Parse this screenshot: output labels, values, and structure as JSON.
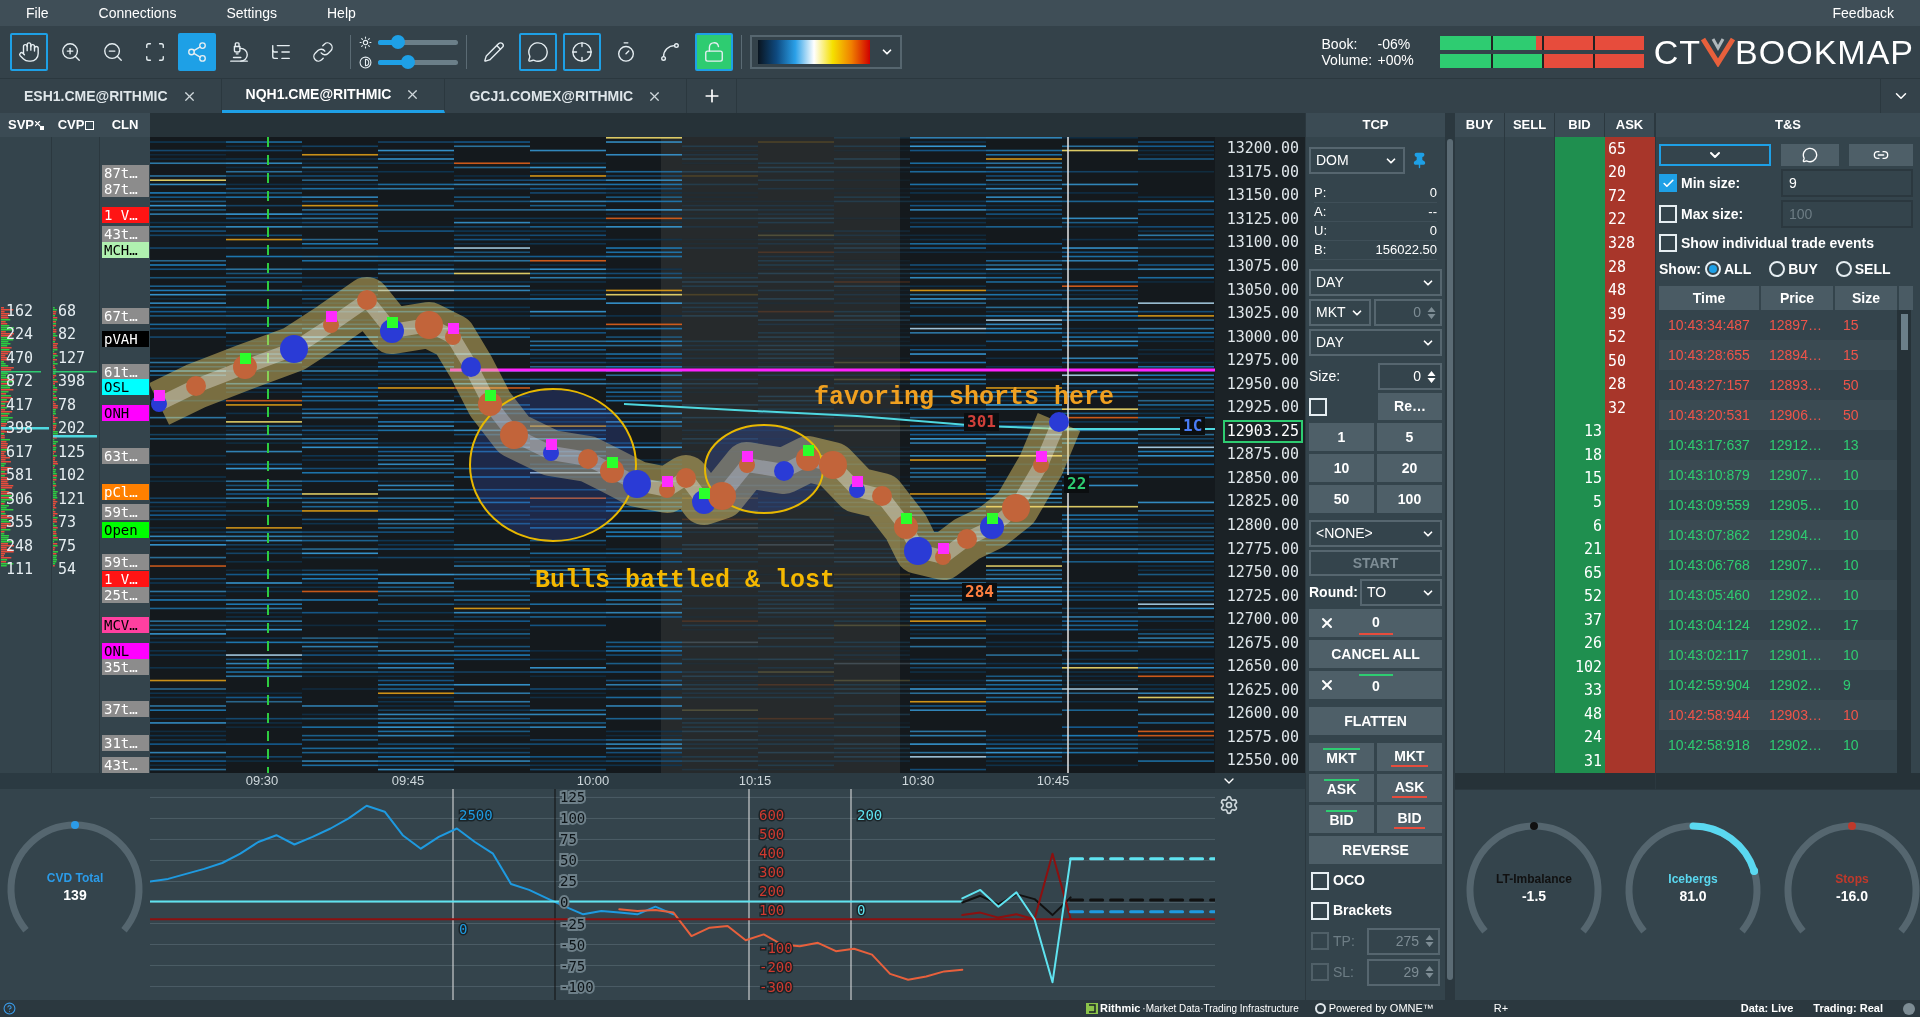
{
  "menu": {
    "items": [
      "File",
      "Connections",
      "Settings",
      "Help"
    ],
    "feedback": "Feedback"
  },
  "toolbar": {
    "tools": [
      {
        "kind": "hand",
        "selected": true,
        "on": false
      },
      {
        "kind": "zoom-in",
        "selected": false,
        "on": false
      },
      {
        "kind": "zoom-out",
        "selected": false,
        "on": false
      },
      {
        "kind": "zoom-fit",
        "selected": false,
        "on": false
      },
      {
        "kind": "share",
        "selected": false,
        "on": true
      },
      {
        "kind": "microscope",
        "selected": false,
        "on": false
      },
      {
        "kind": "tree",
        "selected": false,
        "on": false
      },
      {
        "kind": "link",
        "selected": false,
        "on": false
      }
    ],
    "sliders": [
      {
        "kind": "brightness",
        "level": 0.25
      },
      {
        "kind": "contrast",
        "level": 0.37
      }
    ],
    "tools2": [
      {
        "kind": "pencil",
        "selected": false,
        "on": false
      },
      {
        "kind": "chat",
        "selected": true,
        "on": false
      },
      {
        "kind": "crosshair",
        "selected": true,
        "on": false
      },
      {
        "kind": "timer",
        "selected": false,
        "on": false
      },
      {
        "kind": "chart",
        "selected": false,
        "on": false
      },
      {
        "kind": "unlock",
        "selected": true,
        "on": true
      }
    ]
  },
  "imbalance": [
    {
      "label": "Book:",
      "value": "-06%",
      "level": 0.47
    },
    {
      "label": "Volume:",
      "value": "+00%",
      "level": 0.5
    }
  ],
  "logo": {
    "left": "CT",
    "right": "BOOKMAP"
  },
  "tabs": [
    {
      "label": "ESH1.CME@RITHMIC",
      "selected": false
    },
    {
      "label": "NQH1.CME@RITHMIC",
      "selected": true
    },
    {
      "label": "GCJ1.COMEX@RITHMIC",
      "selected": false
    }
  ],
  "columns": {
    "svp": "SVP",
    "cvp": "CVP",
    "cln": "CLN"
  },
  "profile": {
    "svp": [
      "162",
      "224",
      "470",
      "872",
      "417",
      "398",
      "617",
      "581",
      "306",
      "355",
      "248",
      "111"
    ],
    "cvp": [
      "68",
      "82",
      "127",
      "398",
      "78",
      "202",
      "125",
      "102",
      "121",
      "73",
      "75",
      "54"
    ]
  },
  "levels": [
    {
      "text": "87t…",
      "color": "#8c8c8c",
      "dark_text": false
    },
    {
      "text": "87t…",
      "color": "#8c8c8c",
      "dark_text": false
    },
    {
      "text": "1 V…",
      "color": "#ff1414",
      "dark_text": false
    },
    {
      "text": "43t…",
      "color": "#8c8c8c",
      "dark_text": false
    },
    {
      "text": "MCH…",
      "color": "#b0f0b0",
      "dark_text": true
    },
    {
      "text": "67t…",
      "color": "#8c8c8c",
      "dark_text": false
    },
    {
      "text": "pVAH",
      "color": "#000000",
      "dark_text": false
    },
    {
      "text": "61t…",
      "color": "#8c8c8c",
      "dark_text": false
    },
    {
      "text": "OSL",
      "color": "#00ffff",
      "dark_text": true
    },
    {
      "text": "ONH",
      "color": "#ff00ff",
      "dark_text": true
    },
    {
      "text": "63t…",
      "color": "#8c8c8c",
      "dark_text": false
    },
    {
      "text": "pCl…",
      "color": "#ff8000",
      "dark_text": false
    },
    {
      "text": "59t…",
      "color": "#8c8c8c",
      "dark_text": false
    },
    {
      "text": "Open",
      "color": "#00ff00",
      "dark_text": true
    },
    {
      "text": "59t…",
      "color": "#8c8c8c",
      "dark_text": false
    },
    {
      "text": "1 V…",
      "color": "#ff1414",
      "dark_text": false
    },
    {
      "text": "25t…",
      "color": "#8c8c8c",
      "dark_text": false
    },
    {
      "text": "MCV…",
      "color": "#ff40a0",
      "dark_text": true
    },
    {
      "text": "ONL",
      "color": "#ff00ff",
      "dark_text": true
    },
    {
      "text": "35t…",
      "color": "#8c8c8c",
      "dark_text": false
    },
    {
      "text": "37t…",
      "color": "#8c8c8c",
      "dark_text": false
    },
    {
      "text": "31t…",
      "color": "#8c8c8c",
      "dark_text": false
    },
    {
      "text": "43t…",
      "color": "#8c8c8c",
      "dark_text": false
    }
  ],
  "heatmap": {
    "notes": [
      {
        "text": "favoring shorts here",
        "color": "#f0a020"
      },
      {
        "text": "Bulls battled & lost",
        "color": "#f5b800"
      }
    ],
    "labels": [
      {
        "text": "301",
        "color": "#d0403a"
      },
      {
        "text": "284",
        "color": "#ff8040"
      },
      {
        "text": "22",
        "color": "#2ecc71"
      },
      {
        "text": "1C",
        "color": "#4a7cf5"
      }
    ]
  },
  "time_axis": [
    "09:30",
    "09:45",
    "10:00",
    "10:15",
    "10:30",
    "10:45"
  ],
  "dom": {
    "columns": [
      "BUY",
      "SELL",
      "BID",
      "ASK"
    ],
    "rows": [
      {
        "price": "13200.00",
        "ask": "65",
        "current": false
      },
      {
        "price": "13175.00",
        "ask": "20",
        "current": false
      },
      {
        "price": "13150.00",
        "ask": "72",
        "current": false
      },
      {
        "price": "13125.00",
        "ask": "22",
        "current": false
      },
      {
        "price": "13100.00",
        "ask": "328",
        "current": false
      },
      {
        "price": "13075.00",
        "ask": "28",
        "current": false
      },
      {
        "price": "13050.00",
        "ask": "48",
        "current": false
      },
      {
        "price": "13025.00",
        "ask": "39",
        "current": false
      },
      {
        "price": "13000.00",
        "ask": "52",
        "current": false
      },
      {
        "price": "12975.00",
        "ask": "50",
        "current": false
      },
      {
        "price": "12950.00",
        "ask": "28",
        "current": false
      },
      {
        "price": "12925.00",
        "ask": "32",
        "current": false
      },
      {
        "price": "12903.25",
        "bid": "13",
        "current": true
      },
      {
        "price": "12875.00",
        "bid": "18",
        "current": false
      },
      {
        "price": "12850.00",
        "bid": "15",
        "current": false
      },
      {
        "price": "12825.00",
        "bid": "5",
        "current": false
      },
      {
        "price": "12800.00",
        "bid": "6",
        "current": false
      },
      {
        "price": "12775.00",
        "bid": "21",
        "current": false
      },
      {
        "price": "12750.00",
        "bid": "65",
        "current": false
      },
      {
        "price": "12725.00",
        "bid": "52",
        "current": false
      },
      {
        "price": "12700.00",
        "bid": "37",
        "current": false
      },
      {
        "price": "12675.00",
        "bid": "26",
        "current": false
      },
      {
        "price": "12650.00",
        "bid": "102",
        "current": false
      },
      {
        "price": "12625.00",
        "bid": "33",
        "current": false
      },
      {
        "price": "12600.00",
        "bid": "48",
        "current": false
      },
      {
        "price": "12575.00",
        "bid": "24",
        "current": false
      },
      {
        "price": "12550.00",
        "bid": "31",
        "current": false
      }
    ]
  },
  "tcp": {
    "title": "TCP",
    "mode": "DOM",
    "account": [
      {
        "label": "P:",
        "value": "0"
      },
      {
        "label": "A:",
        "value": "--"
      },
      {
        "label": "U:",
        "value": "0"
      },
      {
        "label": "B:",
        "value": "156022.50"
      }
    ],
    "duration": "DAY",
    "order_type": "MKT",
    "price_offset": {
      "value": "0",
      "disabled": true
    },
    "duration2": "DAY",
    "size": {
      "label": "Size:",
      "value": "0"
    },
    "reload": {
      "checked": false,
      "button": "Re…"
    },
    "quick_sizes": [
      "1",
      "5",
      "10",
      "20",
      "50",
      "100"
    ],
    "strategy": "<NONE>",
    "start": {
      "label": "START",
      "disabled": true
    },
    "round": {
      "label": "Round:",
      "value": "TO"
    },
    "cancels": [
      {
        "value": "0",
        "color": "#e74c3c"
      },
      {
        "value": "0",
        "color": "#2ecc71"
      }
    ],
    "cancel_all": "CANCEL ALL",
    "flatten": "FLATTEN",
    "order_buttons": [
      {
        "label": "MKT",
        "color": "#2ecc71"
      },
      {
        "label": "MKT",
        "color": "#e74c3c"
      },
      {
        "label": "ASK",
        "color": "#2ecc71"
      },
      {
        "label": "ASK",
        "color": "#e74c3c"
      },
      {
        "label": "BID",
        "color": "#2ecc71"
      },
      {
        "label": "BID",
        "color": "#e74c3c"
      }
    ],
    "reverse": "REVERSE",
    "options": [
      {
        "label": "OCO",
        "checked": false
      },
      {
        "label": "Brackets",
        "checked": false
      }
    ],
    "brackets": [
      {
        "label": "TP:",
        "value": "275",
        "checked": false,
        "disabled": true
      },
      {
        "label": "SL:",
        "value": "29",
        "checked": false,
        "disabled": true
      }
    ]
  },
  "ts": {
    "title": "T&S",
    "min_size": {
      "label": "Min size:",
      "checked": true,
      "value": "9"
    },
    "max_size": {
      "label": "Max size:",
      "checked": false,
      "value": "100"
    },
    "individual": {
      "label": "Show individual trade events",
      "checked": false
    },
    "show": {
      "label": "Show:",
      "options": [
        {
          "label": "ALL",
          "selected": true
        },
        {
          "label": "BUY",
          "selected": false
        },
        {
          "label": "SELL",
          "selected": false
        }
      ]
    },
    "columns": [
      "Time",
      "Price",
      "Size"
    ],
    "rows": [
      {
        "time": "10:43:34:487",
        "price": "12897…",
        "size": "15",
        "color": "#f0544a"
      },
      {
        "time": "10:43:28:655",
        "price": "12894…",
        "size": "15",
        "color": "#f0544a"
      },
      {
        "time": "10:43:27:157",
        "price": "12893…",
        "size": "50",
        "color": "#f0544a"
      },
      {
        "time": "10:43:20:531",
        "price": "12906…",
        "size": "50",
        "color": "#f0544a"
      },
      {
        "time": "10:43:17:637",
        "price": "12912…",
        "size": "13",
        "color": "#2ecc71"
      },
      {
        "time": "10:43:10:879",
        "price": "12907…",
        "size": "10",
        "color": "#2ecc71"
      },
      {
        "time": "10:43:09:559",
        "price": "12905…",
        "size": "10",
        "color": "#2ecc71"
      },
      {
        "time": "10:43:07:862",
        "price": "12904…",
        "size": "10",
        "color": "#2ecc71"
      },
      {
        "time": "10:43:06:768",
        "price": "12907…",
        "size": "10",
        "color": "#2ecc71"
      },
      {
        "time": "10:43:05:460",
        "price": "12902…",
        "size": "10",
        "color": "#2ecc71"
      },
      {
        "time": "10:43:04:124",
        "price": "12902…",
        "size": "17",
        "color": "#2ecc71"
      },
      {
        "time": "10:43:02:117",
        "price": "12901…",
        "size": "10",
        "color": "#2ecc71"
      },
      {
        "time": "10:42:59:904",
        "price": "12902…",
        "size": "9",
        "color": "#2ecc71"
      },
      {
        "time": "10:42:58:944",
        "price": "12903…",
        "size": "10",
        "color": "#f0544a"
      },
      {
        "time": "10:42:58:918",
        "price": "12902…",
        "size": "10",
        "color": "#2ecc71"
      }
    ]
  },
  "indicator": {
    "scales": [
      {
        "color": "#1e9ae0",
        "labels": [
          "2500",
          "0"
        ]
      },
      {
        "color": "#d03a30",
        "labels": [
          "600",
          "500",
          "400",
          "300",
          "200",
          "100",
          "-100",
          "-200",
          "-300"
        ]
      },
      {
        "color": "#5fe3f0",
        "labels": [
          "200",
          "0"
        ]
      }
    ],
    "chart_data": {
      "type": "line",
      "ylim": [
        -116,
        135
      ],
      "grid": true,
      "yticks": [
        125,
        100,
        75,
        50,
        25,
        0,
        -25,
        -50,
        -75,
        -100
      ],
      "series": [
        {
          "color": "#1e9ae0",
          "values": [
            25,
            28,
            34,
            40,
            47,
            58,
            72,
            80,
            69,
            78,
            88,
            100,
            115,
            108,
            80,
            64,
            78,
            88,
            72,
            58,
            22,
            15,
            5,
            -5,
            -14,
            -10,
            -12,
            -14,
            -5,
            -14,
            null,
            null,
            null,
            null,
            null,
            null,
            null,
            null,
            null,
            null,
            null,
            null,
            null,
            null,
            null,
            null,
            null,
            null,
            null,
            null,
            null,
            null,
            null,
            null,
            null,
            null,
            null,
            null,
            null,
            null
          ]
        },
        {
          "color": "#e8603c",
          "values": [
            null,
            null,
            null,
            null,
            null,
            null,
            null,
            null,
            null,
            null,
            null,
            null,
            null,
            null,
            null,
            null,
            null,
            null,
            null,
            null,
            null,
            null,
            null,
            null,
            null,
            null,
            -8,
            -10,
            -9,
            -12,
            -40,
            -30,
            -28,
            -45,
            -38,
            -50,
            -52,
            -48,
            -58,
            -55,
            -62,
            -85,
            -92,
            -88,
            -82,
            -80,
            null,
            null,
            null,
            null,
            null,
            null,
            null,
            null,
            null,
            null,
            null,
            null,
            null,
            null
          ]
        },
        {
          "color": "#5fe3f0",
          "values": [
            1,
            1,
            1,
            1,
            1,
            1,
            1,
            1,
            1,
            1,
            1,
            1,
            1,
            1,
            1,
            1,
            1,
            1,
            1,
            1,
            1,
            1,
            1,
            1,
            1,
            1,
            1,
            1,
            1,
            1,
            1,
            1,
            1,
            1,
            1,
            1,
            1,
            1,
            1,
            1,
            1,
            1,
            1,
            1,
            1,
            1,
            null,
            null,
            null,
            null,
            null,
            null,
            null,
            null,
            null,
            null,
            null,
            null,
            null,
            null
          ]
        },
        {
          "color": "#8b1010",
          "values": [
            -20,
            -20,
            -20,
            -20,
            -20,
            -20,
            -20,
            -20,
            -20,
            -20,
            -20,
            -20,
            -20,
            -20,
            -20,
            -20,
            -20,
            -20,
            -20,
            -20,
            -20,
            -20,
            -20,
            -20,
            -20,
            -20,
            -20,
            -20,
            -20,
            -20,
            -20,
            -20,
            -20,
            -20,
            -20,
            -20,
            -20,
            -20,
            -20,
            -20,
            -20,
            -20,
            -20,
            -20,
            -20,
            -20,
            -20,
            -20,
            -20,
            -20,
            -20,
            -20,
            -20,
            -20,
            -20,
            -20,
            -20,
            -20,
            -20,
            -20
          ]
        },
        {
          "color": "#111111",
          "values": [
            null,
            null,
            null,
            null,
            null,
            null,
            null,
            null,
            null,
            null,
            null,
            null,
            null,
            null,
            null,
            null,
            null,
            null,
            null,
            null,
            null,
            null,
            null,
            null,
            null,
            null,
            null,
            null,
            null,
            null,
            null,
            null,
            null,
            null,
            null,
            null,
            null,
            null,
            null,
            null,
            null,
            null,
            null,
            null,
            null,
            0,
            8,
            -2,
            10,
            4,
            -15,
            6,
            null,
            null,
            null,
            null,
            null,
            null,
            null,
            null
          ]
        },
        {
          "color": "#8b1010",
          "values": [
            null,
            null,
            null,
            null,
            null,
            null,
            null,
            null,
            null,
            null,
            null,
            null,
            null,
            null,
            null,
            null,
            null,
            null,
            null,
            null,
            null,
            null,
            null,
            null,
            null,
            null,
            null,
            null,
            null,
            null,
            null,
            null,
            null,
            null,
            null,
            null,
            null,
            null,
            null,
            null,
            null,
            null,
            null,
            null,
            null,
            -15,
            -12,
            -18,
            -14,
            -20,
            58,
            -19,
            null,
            null,
            null,
            null,
            null,
            null,
            null,
            null
          ]
        },
        {
          "color": "#5fe3f0",
          "values": [
            null,
            null,
            null,
            null,
            null,
            null,
            null,
            null,
            null,
            null,
            null,
            null,
            null,
            null,
            null,
            null,
            null,
            null,
            null,
            null,
            null,
            null,
            null,
            null,
            null,
            null,
            null,
            null,
            null,
            null,
            null,
            null,
            null,
            null,
            null,
            null,
            null,
            null,
            null,
            null,
            null,
            null,
            null,
            null,
            null,
            5,
            15,
            -5,
            12,
            -20,
            -95,
            52,
            null,
            null,
            null,
            null,
            null,
            null,
            null,
            null
          ]
        },
        {
          "color": "#5fe3f0",
          "line_style": "dashed",
          "values": [
            null,
            null,
            null,
            null,
            null,
            null,
            null,
            null,
            null,
            null,
            null,
            null,
            null,
            null,
            null,
            null,
            null,
            null,
            null,
            null,
            null,
            null,
            null,
            null,
            null,
            null,
            null,
            null,
            null,
            null,
            null,
            null,
            null,
            null,
            null,
            null,
            null,
            null,
            null,
            null,
            null,
            null,
            null,
            null,
            null,
            null,
            null,
            null,
            null,
            null,
            null,
            52,
            52,
            52,
            52,
            52,
            52,
            52,
            52,
            52
          ]
        },
        {
          "color": "#111111",
          "line_style": "dashed",
          "values": [
            null,
            null,
            null,
            null,
            null,
            null,
            null,
            null,
            null,
            null,
            null,
            null,
            null,
            null,
            null,
            null,
            null,
            null,
            null,
            null,
            null,
            null,
            null,
            null,
            null,
            null,
            null,
            null,
            null,
            null,
            null,
            null,
            null,
            null,
            null,
            null,
            null,
            null,
            null,
            null,
            null,
            null,
            null,
            null,
            null,
            null,
            null,
            null,
            null,
            null,
            null,
            3,
            3,
            3,
            3,
            3,
            3,
            3,
            3,
            3
          ]
        },
        {
          "color": "#1e9ae0",
          "line_style": "dashed",
          "values": [
            null,
            null,
            null,
            null,
            null,
            null,
            null,
            null,
            null,
            null,
            null,
            null,
            null,
            null,
            null,
            null,
            null,
            null,
            null,
            null,
            null,
            null,
            null,
            null,
            null,
            null,
            null,
            null,
            null,
            null,
            null,
            null,
            null,
            null,
            null,
            null,
            null,
            null,
            null,
            null,
            null,
            null,
            null,
            null,
            null,
            null,
            null,
            null,
            null,
            null,
            null,
            -11,
            -11,
            -11,
            -11,
            -11,
            -11,
            -11,
            -11,
            -11
          ]
        }
      ]
    }
  },
  "gauges": [
    {
      "label": "CVD Total",
      "value": "139",
      "color": "#2b9be8",
      "level": 0.5
    },
    {
      "label": "LT-Imbalance",
      "value": "-1.5",
      "color": "#111111",
      "level": 0.5
    },
    {
      "label": "Icebergs",
      "value": "81.0",
      "color": "#5ad8f0",
      "level": 0.78
    },
    {
      "label": "Stops",
      "value": "-16.0",
      "color": "#c0392b",
      "level": 0.5
    }
  ],
  "status": {
    "rithmic": "Rithmic",
    "rithmic_tag": "·Market Data·Trading Infrastructure",
    "powered": "Powered by OMNE™",
    "rplus": "R+",
    "data": "Data: Live",
    "trading": "Trading: Real"
  }
}
